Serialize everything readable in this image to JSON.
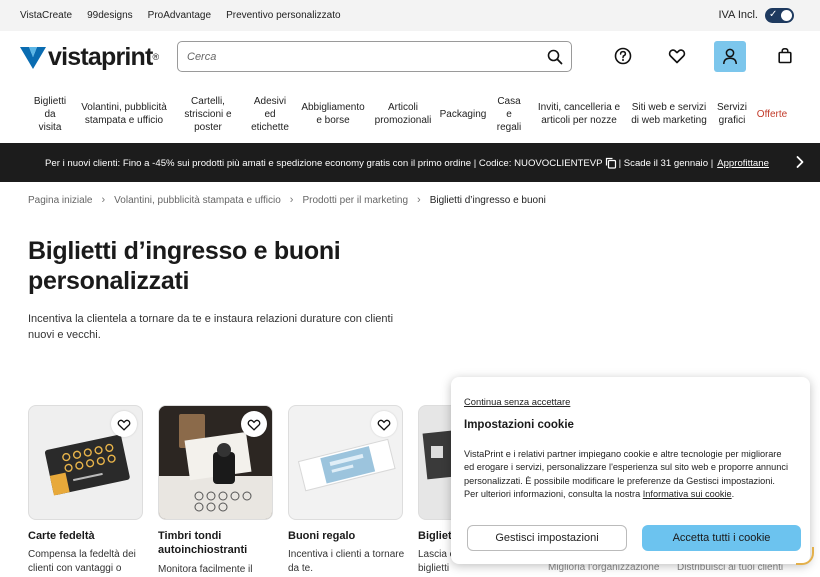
{
  "topbar": {
    "links": [
      "VistaCreate",
      "99designs",
      "ProAdvantage",
      "Preventivo personalizzato"
    ],
    "vat_label": "IVA Incl.",
    "vat_toggle_on": true
  },
  "header": {
    "logo_text": "vistaprint",
    "logo_mark": "®",
    "search_placeholder": "Cerca",
    "icons": [
      "help-icon",
      "heart-icon",
      "account-icon",
      "cart-icon"
    ],
    "account_color": "#7cc6ec"
  },
  "nav": {
    "items": [
      "Biglietti\nda\nvisita",
      "Volantini, pubblicità\nstampata e ufficio",
      "Cartelli,\nstriscioni e\nposter",
      "Adesivi\ned\netichette",
      "Abbigliamento\ne borse",
      "Articoli\npromozionali",
      "Packaging",
      "Casa\ne\nregali",
      "Inviti, cancelleria e\narticoli per nozze",
      "Siti web e servizi\ndi web marketing",
      "Servizi\ngrafici",
      "Offerte"
    ],
    "offer_color": "#c23b2a"
  },
  "promo": {
    "text": "Per i nuovi clienti: Fino a -45% sui prodotti più amati e spedizione economy gratis con il primo ordine | Codice: NUOVOCLIENTEVP",
    "text_after": "| Scade il 31 gennaio |",
    "link": "Approfittane"
  },
  "breadcrumb": [
    "Pagina iniziale",
    "Volantini, pubblicità stampata e ufficio",
    "Prodotti per il marketing",
    "Biglietti d’ingresso e buoni"
  ],
  "page": {
    "title": "Biglietti d’ingresso e buoni personalizzati",
    "subtitle": "Incentiva la clientela a tornare da te e instaura relazioni durature con clienti nuovi e vecchi."
  },
  "products": [
    {
      "title": "Carte fedeltà",
      "desc": "Compensa la fedeltà dei clienti con vantaggi o"
    },
    {
      "title": "Timbri tondi autoinchiostranti",
      "desc": "Monitora facilmente il"
    },
    {
      "title": "Buoni regalo",
      "desc": "Incentiva i clienti a tornare da te."
    },
    {
      "title": "Bigliett",
      "desc": "Lascia c con bellissimi biglietti"
    }
  ],
  "partial_texts": [
    "Miglioria l'organizzazione",
    "Distribuisci ai tuoi clienti"
  ],
  "cookie": {
    "continue_link": "Continua senza accettare",
    "title": "Impostazioni cookie",
    "body": "VistaPrint e i relativi partner impiegano cookie e altre tecnologie per migliorare ed erogare i servizi, personalizzare l'esperienza sul sito web e proporre annunci personalizzati. È possibile modificare le preferenze da Gestisci impostazioni. Per ulteriori informazioni, consulta la nostra",
    "policy_link": "Informativa sui cookie",
    "manage_button": "Gestisci impostazioni",
    "accept_button": "Accetta tutti i cookie",
    "accept_color": "#6cc3ef"
  },
  "colors": {
    "brand_blue": "#0a6cb1",
    "promo_bg": "#1c1c1c",
    "toggle": "#1e3a5f"
  }
}
